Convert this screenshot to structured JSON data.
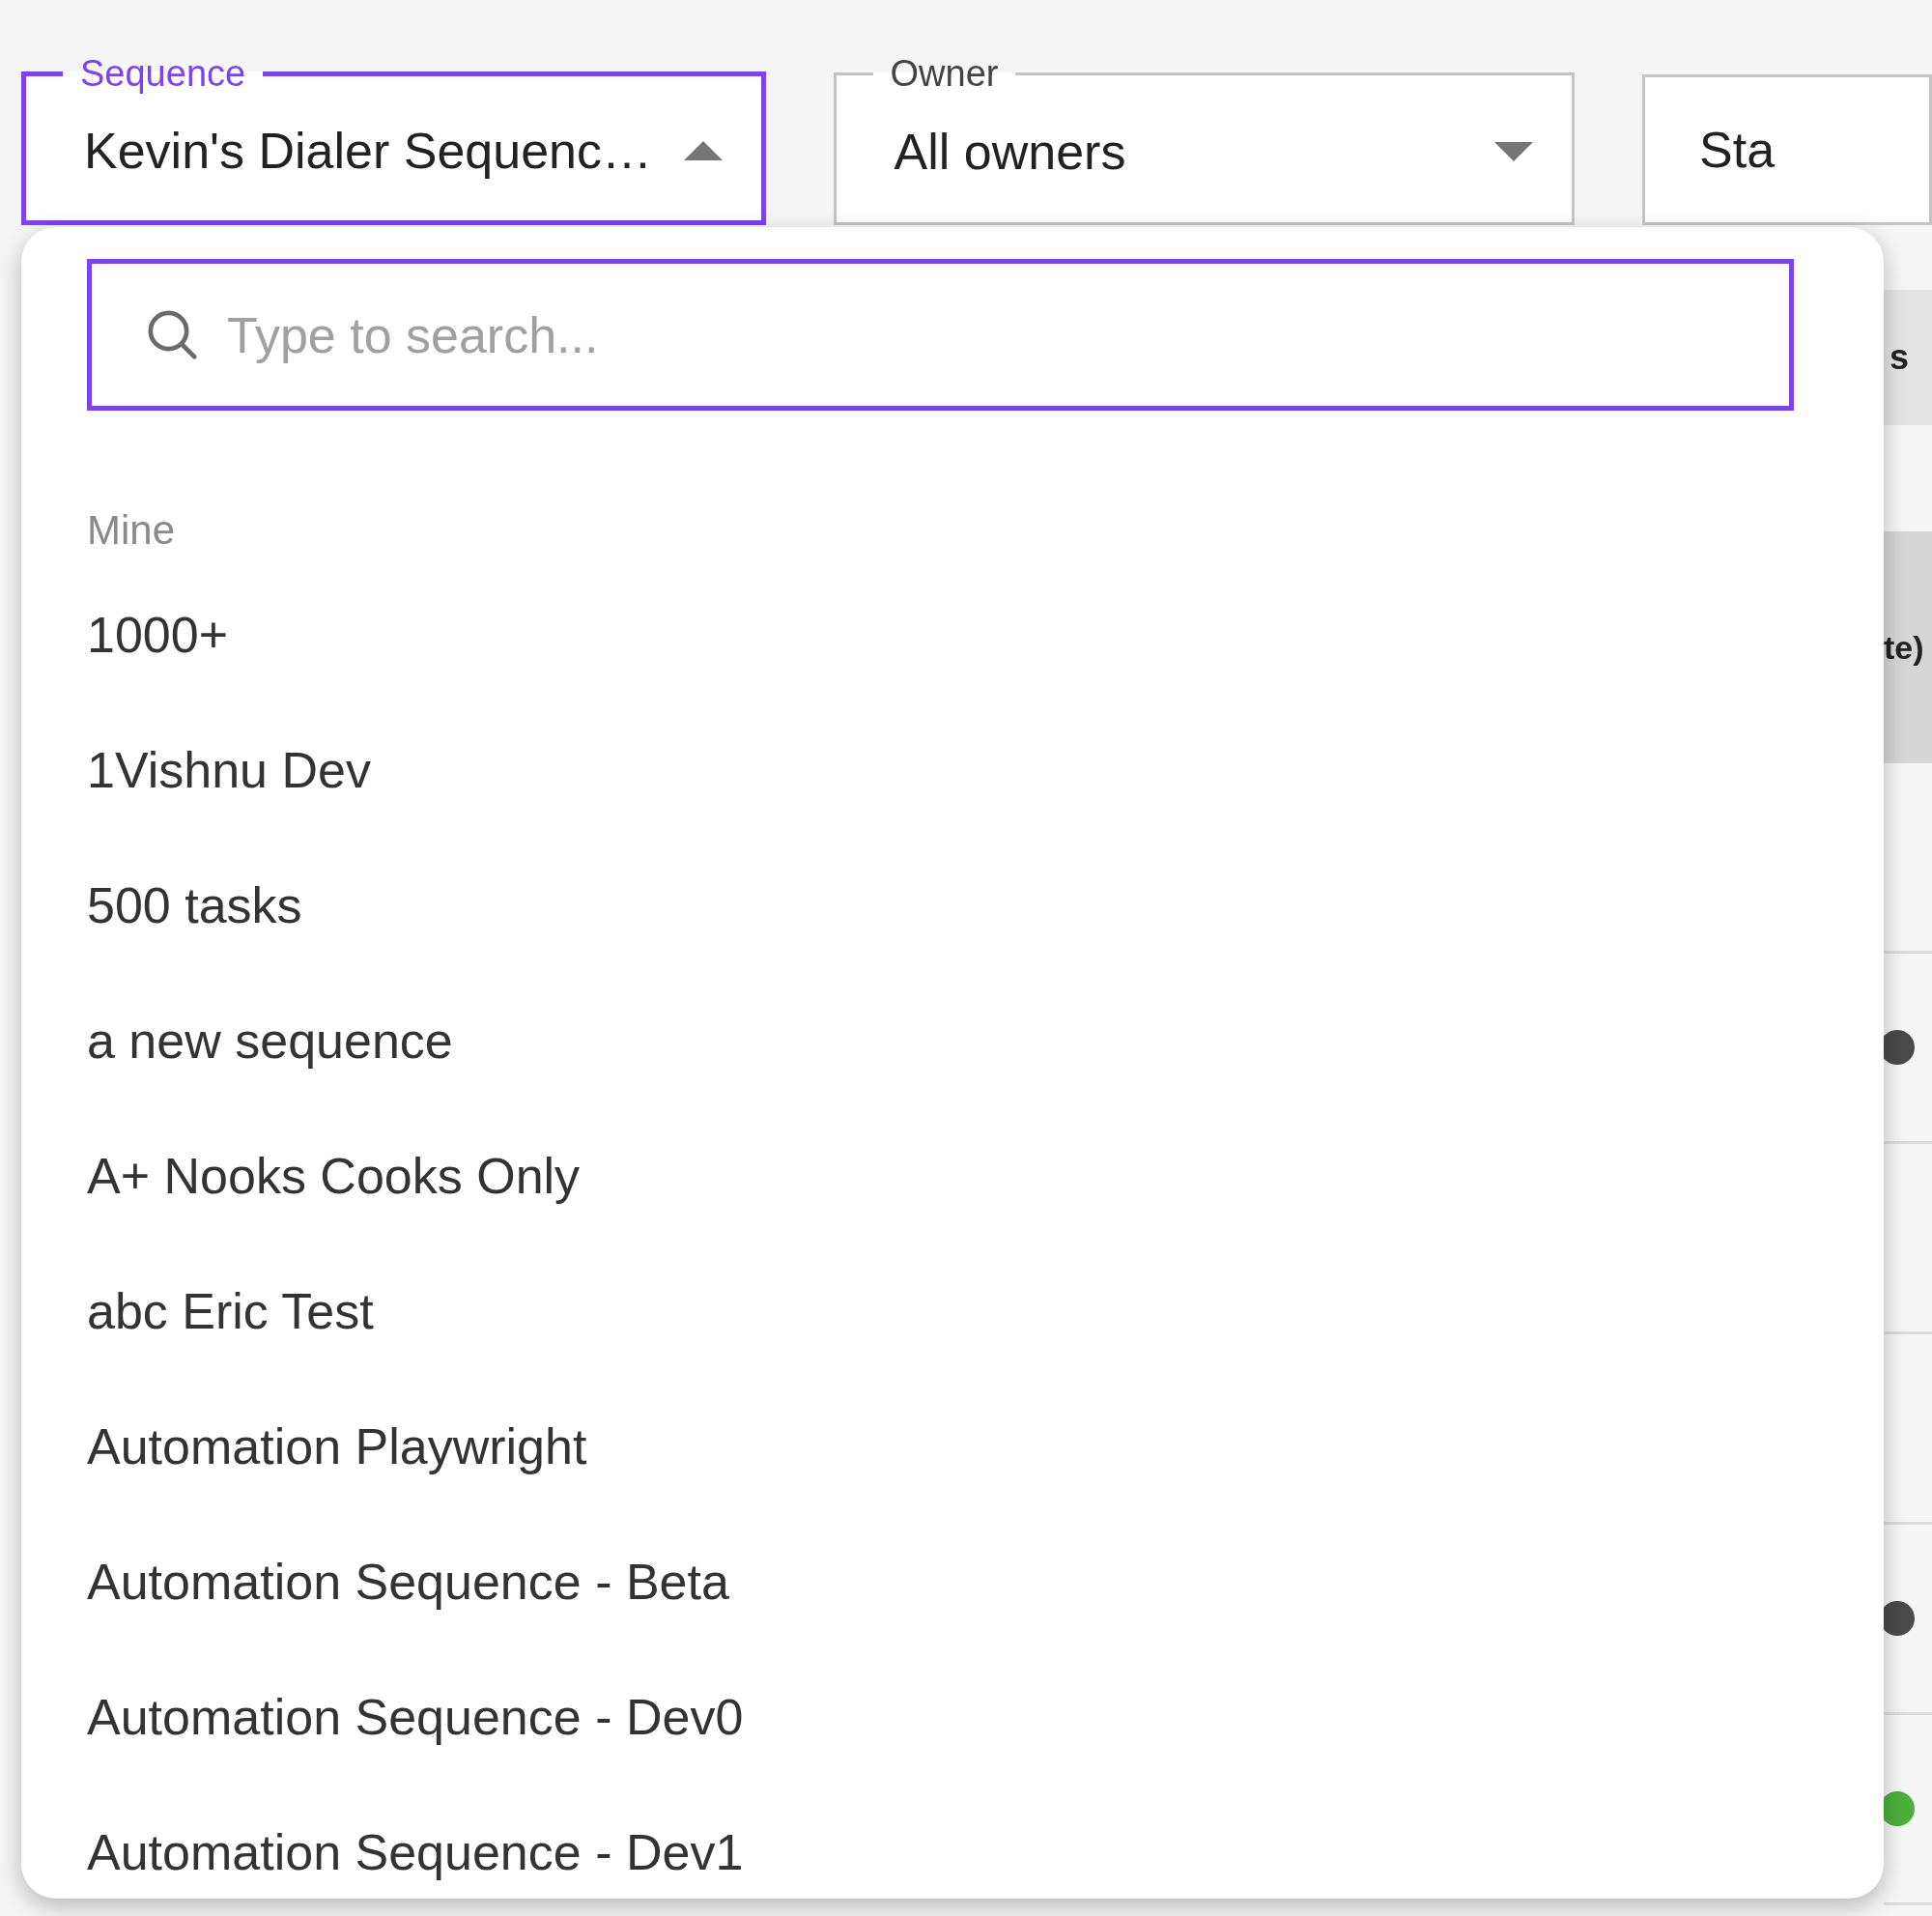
{
  "filters": [
    {
      "label": "Sequence",
      "value": "Kevin's Dialer Sequenc…",
      "expanded": true
    },
    {
      "label": "Owner",
      "value": "All owners",
      "expanded": false
    },
    {
      "value": "Sta",
      "expanded": false
    }
  ],
  "dropdown": {
    "search": {
      "placeholder": "Type to search..."
    },
    "groups": [
      {
        "heading": "Mine",
        "options": [
          "1000+",
          "1Vishnu Dev",
          "500 tasks",
          "a new sequence",
          "A+ Nooks Cooks Only",
          "abc Eric Test",
          "Automation Playwright",
          "Automation Sequence - Beta",
          "Automation Sequence - Dev0",
          "Automation Sequence - Dev1"
        ]
      }
    ]
  },
  "background_table": {
    "chip_label": "s",
    "header": "te)",
    "rows": [
      {},
      {
        "color": "#4a4a4a"
      },
      {},
      {},
      {
        "color": "#4a4a4a"
      },
      {
        "color": "#4caf3a"
      }
    ]
  }
}
